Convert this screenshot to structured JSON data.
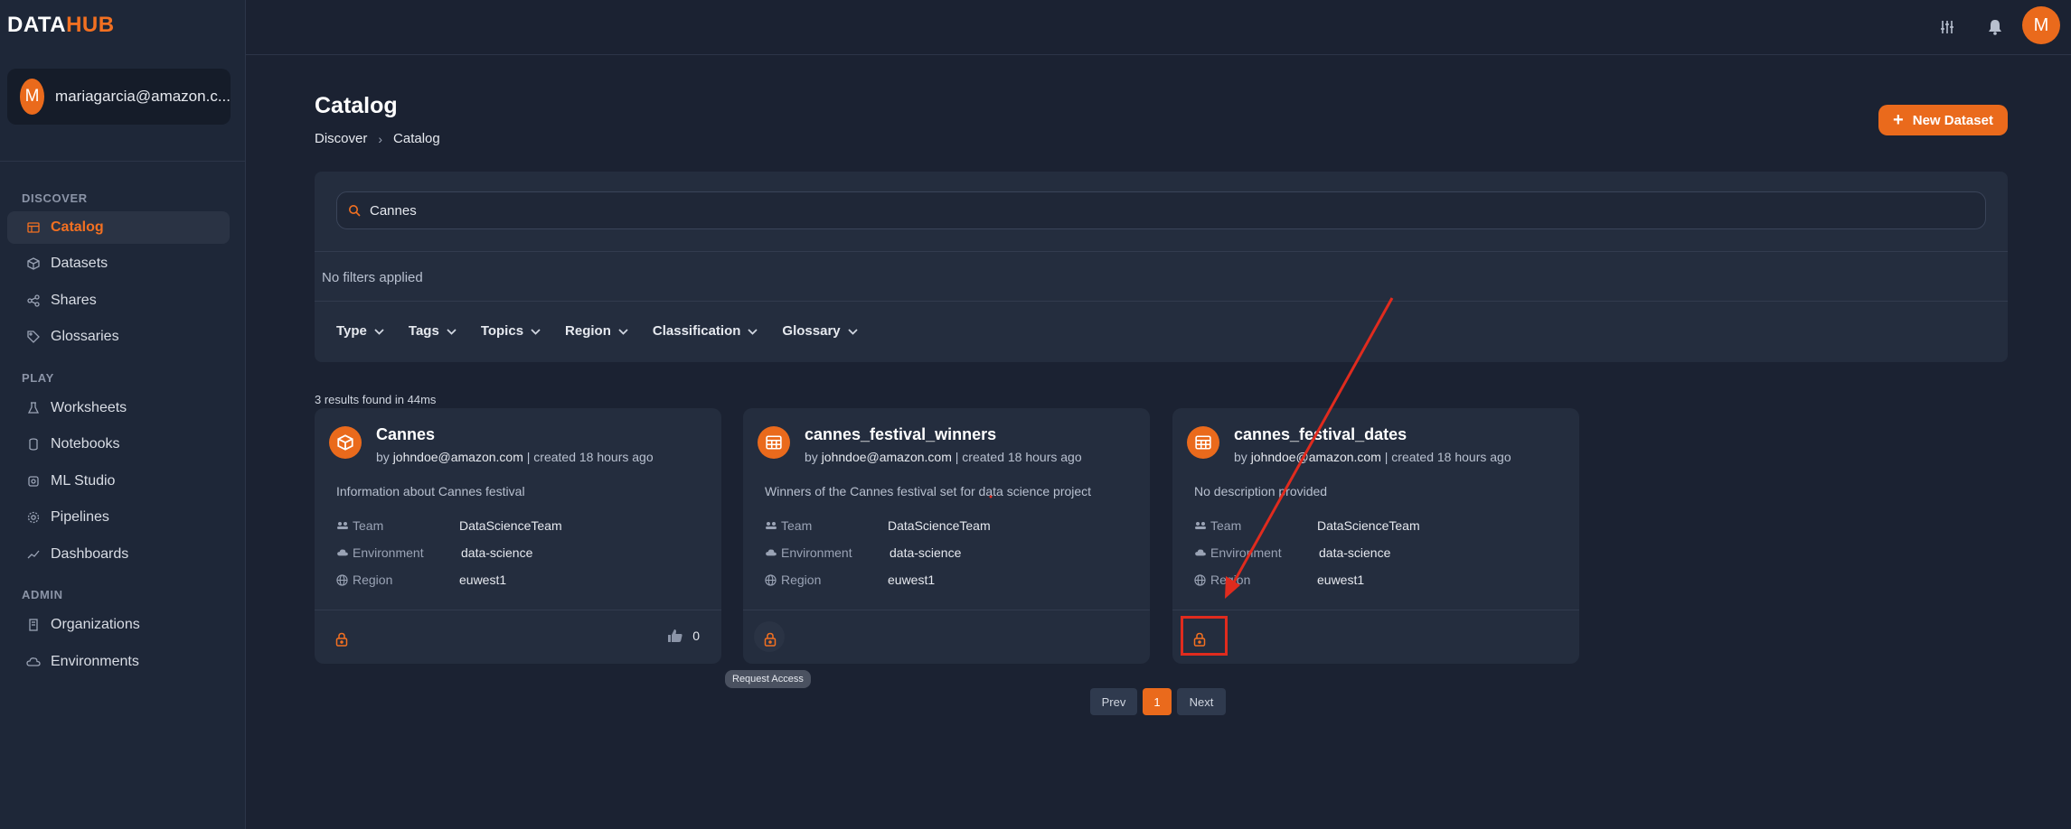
{
  "brand": {
    "part1": "DATA",
    "part2": "HUB"
  },
  "user": {
    "initial": "M",
    "email": "mariagarcia@amazon.c..."
  },
  "sidebar": {
    "sections": [
      {
        "title": "DISCOVER",
        "items": [
          {
            "label": "Catalog",
            "icon": "catalog-icon",
            "active": true
          },
          {
            "label": "Datasets",
            "icon": "cube-icon"
          },
          {
            "label": "Shares",
            "icon": "share-icon"
          },
          {
            "label": "Glossaries",
            "icon": "tag-icon"
          }
        ]
      },
      {
        "title": "PLAY",
        "items": [
          {
            "label": "Worksheets",
            "icon": "flask-icon"
          },
          {
            "label": "Notebooks",
            "icon": "notebook-icon"
          },
          {
            "label": "ML Studio",
            "icon": "ml-icon"
          },
          {
            "label": "Pipelines",
            "icon": "gear-icon"
          },
          {
            "label": "Dashboards",
            "icon": "chart-line-icon"
          }
        ]
      },
      {
        "title": "ADMIN",
        "items": [
          {
            "label": "Organizations",
            "icon": "building-icon"
          },
          {
            "label": "Environments",
            "icon": "cloud-icon"
          }
        ]
      }
    ]
  },
  "topbar": {
    "avatar_initial": "M",
    "icons": [
      "settings-sliders-icon",
      "bell-icon"
    ]
  },
  "page": {
    "title": "Catalog",
    "breadcrumb": [
      "Discover",
      "Catalog"
    ],
    "new_button": "New Dataset"
  },
  "search": {
    "value": "Cannes",
    "placeholder": "Search"
  },
  "filters": {
    "status": "No filters applied",
    "buttons": [
      "Type",
      "Tags",
      "Topics",
      "Region",
      "Classification",
      "Glossary"
    ]
  },
  "results": {
    "summary": "3 results found in 44ms"
  },
  "cards": [
    {
      "title": "Cannes",
      "icon": "cube-icon",
      "by_prefix": "by",
      "owner": "johndoe@amazon.com",
      "created": "| created 18 hours ago",
      "description": "Information about Cannes festival",
      "team_label": "Team",
      "team": "DataScienceTeam",
      "env_label": "Environment",
      "environment": "data-science",
      "region_label": "Region",
      "region": "euwest1",
      "likes": "0"
    },
    {
      "title": "cannes_festival_winners",
      "icon": "table-icon",
      "by_prefix": "by",
      "owner": "johndoe@amazon.com",
      "created": "| created 18 hours ago",
      "description": "Winners of the Cannes festival set for data science project",
      "team_label": "Team",
      "team": "DataScienceTeam",
      "env_label": "Environment",
      "environment": "data-science",
      "region_label": "Region",
      "region": "euwest1"
    },
    {
      "title": "cannes_festival_dates",
      "icon": "table-icon",
      "by_prefix": "by",
      "owner": "johndoe@amazon.com",
      "created": "| created 18 hours ago",
      "description": "No description provided",
      "team_label": "Team",
      "team": "DataScienceTeam",
      "env_label": "Environment",
      "environment": "data-science",
      "region_label": "Region",
      "region": "euwest1"
    }
  ],
  "tooltip": "Request Access",
  "pagination": {
    "prev": "Prev",
    "current": "1",
    "next": "Next"
  },
  "colors": {
    "accent": "#ea6a1c",
    "background": "#1b2232",
    "card": "#242d3e",
    "annotation": "#e02b1e"
  }
}
